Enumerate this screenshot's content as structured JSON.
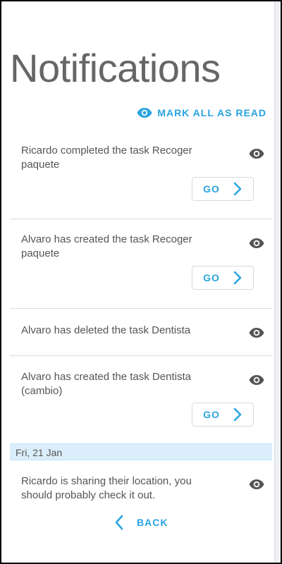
{
  "page": {
    "title": "Notifications"
  },
  "actions": {
    "mark_all_label": "MARK ALL AS READ"
  },
  "notifications": [
    {
      "text": "Ricardo completed the task Recoger paquete",
      "go_label": "GO"
    },
    {
      "text": "Alvaro has created the task Recoger paquete",
      "go_label": "GO"
    },
    {
      "text": "Alvaro has deleted the task Dentista"
    },
    {
      "text": "Alvaro has created the task Dentista (cambio)",
      "go_label": "GO"
    }
  ],
  "date_section": {
    "label": "Fri, 21 Jan"
  },
  "older": [
    {
      "text": "Ricardo is sharing their location, you should probably check it out."
    }
  ],
  "footer": {
    "back_label": "BACK"
  },
  "icons": {
    "mark_all": "eye-icon",
    "read": "eye-icon",
    "go": "chevron-right-icon",
    "back": "chevron-left-icon"
  },
  "colors": {
    "accent": "#29a3e0",
    "text": "#555555",
    "title": "#666666",
    "section_bg": "#dbeefb",
    "divider": "#d8dadd"
  }
}
